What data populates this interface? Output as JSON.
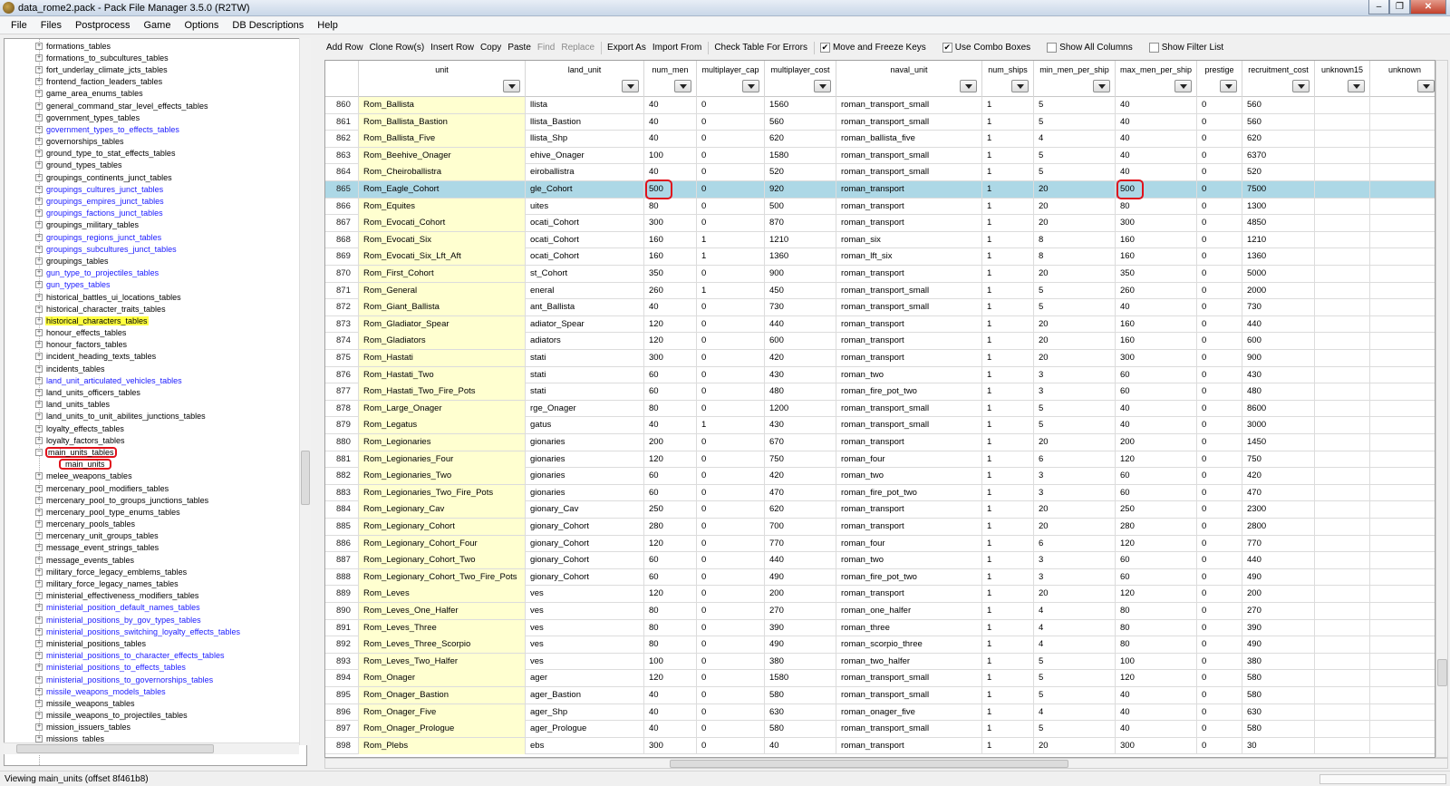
{
  "window": {
    "title": "data_rome2.pack - Pack File Manager 3.5.0 (R2TW)",
    "controls": [
      "–",
      "❐",
      "✕"
    ]
  },
  "menu": [
    "File",
    "Files",
    "Postprocess",
    "Game",
    "Options",
    "DB Descriptions",
    "Help"
  ],
  "tree": [
    {
      "label": "formations_tables"
    },
    {
      "label": "formations_to_subcultures_tables"
    },
    {
      "label": "fort_underlay_climate_jcts_tables"
    },
    {
      "label": "frontend_faction_leaders_tables"
    },
    {
      "label": "game_area_enums_tables"
    },
    {
      "label": "general_command_star_level_effects_tables"
    },
    {
      "label": "government_types_tables"
    },
    {
      "label": "government_types_to_effects_tables",
      "blue": true
    },
    {
      "label": "governorships_tables"
    },
    {
      "label": "ground_type_to_stat_effects_tables"
    },
    {
      "label": "ground_types_tables"
    },
    {
      "label": "groupings_continents_junct_tables"
    },
    {
      "label": "groupings_cultures_junct_tables",
      "blue": true
    },
    {
      "label": "groupings_empires_junct_tables",
      "blue": true
    },
    {
      "label": "groupings_factions_junct_tables",
      "blue": true
    },
    {
      "label": "groupings_military_tables"
    },
    {
      "label": "groupings_regions_junct_tables",
      "blue": true
    },
    {
      "label": "groupings_subcultures_junct_tables",
      "blue": true
    },
    {
      "label": "groupings_tables"
    },
    {
      "label": "gun_type_to_projectiles_tables",
      "blue": true
    },
    {
      "label": "gun_types_tables",
      "blue": true
    },
    {
      "label": "historical_battles_ui_locations_tables"
    },
    {
      "label": "historical_character_traits_tables"
    },
    {
      "label": "historical_characters_tables",
      "highlight": true
    },
    {
      "label": "honour_effects_tables"
    },
    {
      "label": "honour_factors_tables"
    },
    {
      "label": "incident_heading_texts_tables"
    },
    {
      "label": "incidents_tables"
    },
    {
      "label": "land_unit_articulated_vehicles_tables",
      "blue": true
    },
    {
      "label": "land_units_officers_tables"
    },
    {
      "label": "land_units_tables"
    },
    {
      "label": "land_units_to_unit_abilites_junctions_tables"
    },
    {
      "label": "loyalty_effects_tables"
    },
    {
      "label": "loyalty_factors_tables"
    },
    {
      "label": "main_units_tables",
      "expanded": true,
      "circled": true
    },
    {
      "label": "main_units",
      "child": true
    },
    {
      "label": "melee_weapons_tables"
    },
    {
      "label": "mercenary_pool_modifiers_tables"
    },
    {
      "label": "mercenary_pool_to_groups_junctions_tables"
    },
    {
      "label": "mercenary_pool_type_enums_tables"
    },
    {
      "label": "mercenary_pools_tables"
    },
    {
      "label": "mercenary_unit_groups_tables"
    },
    {
      "label": "message_event_strings_tables"
    },
    {
      "label": "message_events_tables"
    },
    {
      "label": "military_force_legacy_emblems_tables"
    },
    {
      "label": "military_force_legacy_names_tables"
    },
    {
      "label": "ministerial_effectiveness_modifiers_tables"
    },
    {
      "label": "ministerial_position_default_names_tables",
      "blue": true
    },
    {
      "label": "ministerial_positions_by_gov_types_tables",
      "blue": true
    },
    {
      "label": "ministerial_positions_switching_loyalty_effects_tables",
      "blue": true
    },
    {
      "label": "ministerial_positions_tables"
    },
    {
      "label": "ministerial_positions_to_character_effects_tables",
      "blue": true
    },
    {
      "label": "ministerial_positions_to_effects_tables",
      "blue": true
    },
    {
      "label": "ministerial_positions_to_governorships_tables",
      "blue": true
    },
    {
      "label": "missile_weapons_models_tables",
      "blue": true
    },
    {
      "label": "missile_weapons_tables"
    },
    {
      "label": "missile_weapons_to_projectiles_tables"
    },
    {
      "label": "mission_issuers_tables"
    },
    {
      "label": "missions_tables"
    }
  ],
  "toolbar": {
    "buttons": [
      "Add Row",
      "Clone Row(s)",
      "Insert Row",
      "Copy",
      "Paste",
      "Find",
      "Replace",
      "Export As",
      "Import From",
      "Check Table For Errors"
    ],
    "disabled": [
      "Find",
      "Replace"
    ],
    "checks": [
      {
        "label": "Move and Freeze Keys",
        "checked": true
      },
      {
        "label": "Use Combo Boxes",
        "checked": true
      },
      {
        "label": "Show All Columns",
        "checked": false
      },
      {
        "label": "Show Filter List",
        "checked": false
      }
    ]
  },
  "columns": [
    "unit",
    "land_unit",
    "num_men",
    "multiplayer_cap",
    "multiplayer_cost",
    "naval_unit",
    "num_ships",
    "min_men_per_ship",
    "max_men_per_ship",
    "prestige",
    "recruitment_cost",
    "unknown15",
    "unknown"
  ],
  "rows": [
    [
      "860",
      "Rom_Ballista",
      "llista",
      "40",
      "0",
      "1560",
      "roman_transport_small",
      "1",
      "5",
      "40",
      "0",
      "560"
    ],
    [
      "861",
      "Rom_Ballista_Bastion",
      "llista_Bastion",
      "40",
      "0",
      "560",
      "roman_transport_small",
      "1",
      "5",
      "40",
      "0",
      "560"
    ],
    [
      "862",
      "Rom_Ballista_Five",
      "llista_Shp",
      "40",
      "0",
      "620",
      "roman_ballista_five",
      "1",
      "4",
      "40",
      "0",
      "620"
    ],
    [
      "863",
      "Rom_Beehive_Onager",
      "ehive_Onager",
      "100",
      "0",
      "1580",
      "roman_transport_small",
      "1",
      "5",
      "40",
      "0",
      "6370"
    ],
    [
      "864",
      "Rom_Cheiroballistra",
      "eiroballistra",
      "40",
      "0",
      "520",
      "roman_transport_small",
      "1",
      "5",
      "40",
      "0",
      "520"
    ],
    [
      "865",
      "Rom_Eagle_Cohort",
      "gle_Cohort",
      "500",
      "0",
      "920",
      "roman_transport",
      "1",
      "20",
      "500",
      "0",
      "7500"
    ],
    [
      "866",
      "Rom_Equites",
      "uites",
      "80",
      "0",
      "500",
      "roman_transport",
      "1",
      "20",
      "80",
      "0",
      "1300"
    ],
    [
      "867",
      "Rom_Evocati_Cohort",
      "ocati_Cohort",
      "300",
      "0",
      "870",
      "roman_transport",
      "1",
      "20",
      "300",
      "0",
      "4850"
    ],
    [
      "868",
      "Rom_Evocati_Six",
      "ocati_Cohort",
      "160",
      "1",
      "1210",
      "roman_six",
      "1",
      "8",
      "160",
      "0",
      "1210"
    ],
    [
      "869",
      "Rom_Evocati_Six_Lft_Aft",
      "ocati_Cohort",
      "160",
      "1",
      "1360",
      "roman_lft_six",
      "1",
      "8",
      "160",
      "0",
      "1360"
    ],
    [
      "870",
      "Rom_First_Cohort",
      "st_Cohort",
      "350",
      "0",
      "900",
      "roman_transport",
      "1",
      "20",
      "350",
      "0",
      "5000"
    ],
    [
      "871",
      "Rom_General",
      "eneral",
      "260",
      "1",
      "450",
      "roman_transport_small",
      "1",
      "5",
      "260",
      "0",
      "2000"
    ],
    [
      "872",
      "Rom_Giant_Ballista",
      "ant_Ballista",
      "40",
      "0",
      "730",
      "roman_transport_small",
      "1",
      "5",
      "40",
      "0",
      "730"
    ],
    [
      "873",
      "Rom_Gladiator_Spear",
      "adiator_Spear",
      "120",
      "0",
      "440",
      "roman_transport",
      "1",
      "20",
      "160",
      "0",
      "440"
    ],
    [
      "874",
      "Rom_Gladiators",
      "adiators",
      "120",
      "0",
      "600",
      "roman_transport",
      "1",
      "20",
      "160",
      "0",
      "600"
    ],
    [
      "875",
      "Rom_Hastati",
      "stati",
      "300",
      "0",
      "420",
      "roman_transport",
      "1",
      "20",
      "300",
      "0",
      "900"
    ],
    [
      "876",
      "Rom_Hastati_Two",
      "stati",
      "60",
      "0",
      "430",
      "roman_two",
      "1",
      "3",
      "60",
      "0",
      "430"
    ],
    [
      "877",
      "Rom_Hastati_Two_Fire_Pots",
      "stati",
      "60",
      "0",
      "480",
      "roman_fire_pot_two",
      "1",
      "3",
      "60",
      "0",
      "480"
    ],
    [
      "878",
      "Rom_Large_Onager",
      "rge_Onager",
      "80",
      "0",
      "1200",
      "roman_transport_small",
      "1",
      "5",
      "40",
      "0",
      "8600"
    ],
    [
      "879",
      "Rom_Legatus",
      "gatus",
      "40",
      "1",
      "430",
      "roman_transport_small",
      "1",
      "5",
      "40",
      "0",
      "3000"
    ],
    [
      "880",
      "Rom_Legionaries",
      "gionaries",
      "200",
      "0",
      "670",
      "roman_transport",
      "1",
      "20",
      "200",
      "0",
      "1450"
    ],
    [
      "881",
      "Rom_Legionaries_Four",
      "gionaries",
      "120",
      "0",
      "750",
      "roman_four",
      "1",
      "6",
      "120",
      "0",
      "750"
    ],
    [
      "882",
      "Rom_Legionaries_Two",
      "gionaries",
      "60",
      "0",
      "420",
      "roman_two",
      "1",
      "3",
      "60",
      "0",
      "420"
    ],
    [
      "883",
      "Rom_Legionaries_Two_Fire_Pots",
      "gionaries",
      "60",
      "0",
      "470",
      "roman_fire_pot_two",
      "1",
      "3",
      "60",
      "0",
      "470"
    ],
    [
      "884",
      "Rom_Legionary_Cav",
      "gionary_Cav",
      "250",
      "0",
      "620",
      "roman_transport",
      "1",
      "20",
      "250",
      "0",
      "2300"
    ],
    [
      "885",
      "Rom_Legionary_Cohort",
      "gionary_Cohort",
      "280",
      "0",
      "700",
      "roman_transport",
      "1",
      "20",
      "280",
      "0",
      "2800"
    ],
    [
      "886",
      "Rom_Legionary_Cohort_Four",
      "gionary_Cohort",
      "120",
      "0",
      "770",
      "roman_four",
      "1",
      "6",
      "120",
      "0",
      "770"
    ],
    [
      "887",
      "Rom_Legionary_Cohort_Two",
      "gionary_Cohort",
      "60",
      "0",
      "440",
      "roman_two",
      "1",
      "3",
      "60",
      "0",
      "440"
    ],
    [
      "888",
      "Rom_Legionary_Cohort_Two_Fire_Pots",
      "gionary_Cohort",
      "60",
      "0",
      "490",
      "roman_fire_pot_two",
      "1",
      "3",
      "60",
      "0",
      "490"
    ],
    [
      "889",
      "Rom_Leves",
      "ves",
      "120",
      "0",
      "200",
      "roman_transport",
      "1",
      "20",
      "120",
      "0",
      "200"
    ],
    [
      "890",
      "Rom_Leves_One_Halfer",
      "ves",
      "80",
      "0",
      "270",
      "roman_one_halfer",
      "1",
      "4",
      "80",
      "0",
      "270"
    ],
    [
      "891",
      "Rom_Leves_Three",
      "ves",
      "80",
      "0",
      "390",
      "roman_three",
      "1",
      "4",
      "80",
      "0",
      "390"
    ],
    [
      "892",
      "Rom_Leves_Three_Scorpio",
      "ves",
      "80",
      "0",
      "490",
      "roman_scorpio_three",
      "1",
      "4",
      "80",
      "0",
      "490"
    ],
    [
      "893",
      "Rom_Leves_Two_Halfer",
      "ves",
      "100",
      "0",
      "380",
      "roman_two_halfer",
      "1",
      "5",
      "100",
      "0",
      "380"
    ],
    [
      "894",
      "Rom_Onager",
      "ager",
      "120",
      "0",
      "1580",
      "roman_transport_small",
      "1",
      "5",
      "120",
      "0",
      "580"
    ],
    [
      "895",
      "Rom_Onager_Bastion",
      "ager_Bastion",
      "40",
      "0",
      "580",
      "roman_transport_small",
      "1",
      "5",
      "40",
      "0",
      "580"
    ],
    [
      "896",
      "Rom_Onager_Five",
      "ager_Shp",
      "40",
      "0",
      "630",
      "roman_onager_five",
      "1",
      "4",
      "40",
      "0",
      "630"
    ],
    [
      "897",
      "Rom_Onager_Prologue",
      "ager_Prologue",
      "40",
      "0",
      "580",
      "roman_transport_small",
      "1",
      "5",
      "40",
      "0",
      "580"
    ],
    [
      "898",
      "Rom_Plebs",
      "ebs",
      "300",
      "0",
      "40",
      "roman_transport",
      "1",
      "20",
      "300",
      "0",
      "30"
    ]
  ],
  "selected_row": "865",
  "status": "Viewing main_units (offset 8f461b8)",
  "colors": {
    "accent_circle": "#e0111b",
    "selected_row": "#add8e6",
    "key_column": "#ffffd0",
    "highlight": "#ffff40",
    "link": "#1a1aff"
  }
}
